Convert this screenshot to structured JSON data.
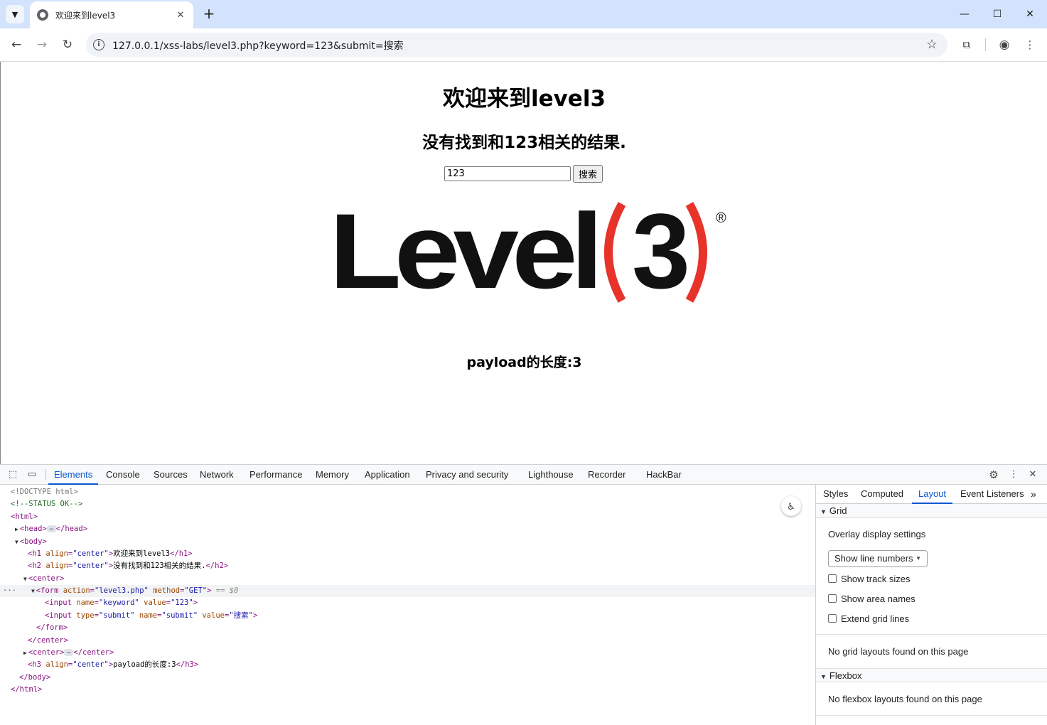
{
  "browser": {
    "tab_title": "欢迎来到level3",
    "url": "127.0.0.1/xss-labs/level3.php?keyword=123&submit=搜索"
  },
  "page": {
    "h1": "欢迎来到level3",
    "h2": "没有找到和123相关的结果.",
    "keyword_value": "123",
    "submit_label": "搜索",
    "logo_text": "Level",
    "logo_number": "3",
    "logo_registered": "®",
    "h3": "payload的长度:3",
    "colors": {
      "logo_red": "#e8332a",
      "logo_black": "#111111"
    }
  },
  "devtools": {
    "tabs": [
      "Elements",
      "Console",
      "Sources",
      "Network",
      "Performance",
      "Memory",
      "Application",
      "Privacy and security",
      "Lighthouse",
      "Recorder",
      "HackBar"
    ],
    "active_tab": "Elements",
    "dom": {
      "doctype": "<!DOCTYPE html>",
      "comment": "<!--STATUS OK-->",
      "html_open": "<html>",
      "head": "<head>",
      "head_close": "</head>",
      "body_open": "<body>",
      "h1_tag": "h1",
      "h1_align": "center",
      "h1_text": "欢迎来到level3",
      "h2_tag": "h2",
      "h2_align": "center",
      "h2_text": "没有找到和123相关的结果.",
      "center_open": "<center>",
      "form_action": "level3.php",
      "form_method": "GET",
      "selected_marker": "== $0",
      "input1_name": "keyword",
      "input1_value": "123",
      "input2_type": "submit",
      "input2_name": "submit",
      "input2_value": "搜索",
      "form_close": "</form>",
      "center_close": "</center>",
      "h3_tag": "h3",
      "h3_align": "center",
      "h3_text": "payload的长度:3",
      "body_close": "</body>",
      "html_close": "</html>"
    },
    "side": {
      "tabs": [
        "Styles",
        "Computed",
        "Layout",
        "Event Listeners"
      ],
      "active_tab": "Layout",
      "grid_header": "Grid",
      "overlay_title": "Overlay display settings",
      "select_value": "Show line numbers",
      "checkboxes": [
        "Show track sizes",
        "Show area names",
        "Extend grid lines"
      ],
      "no_grid": "No grid layouts found on this page",
      "flexbox_header": "Flexbox",
      "no_flexbox": "No flexbox layouts found on this page"
    }
  }
}
